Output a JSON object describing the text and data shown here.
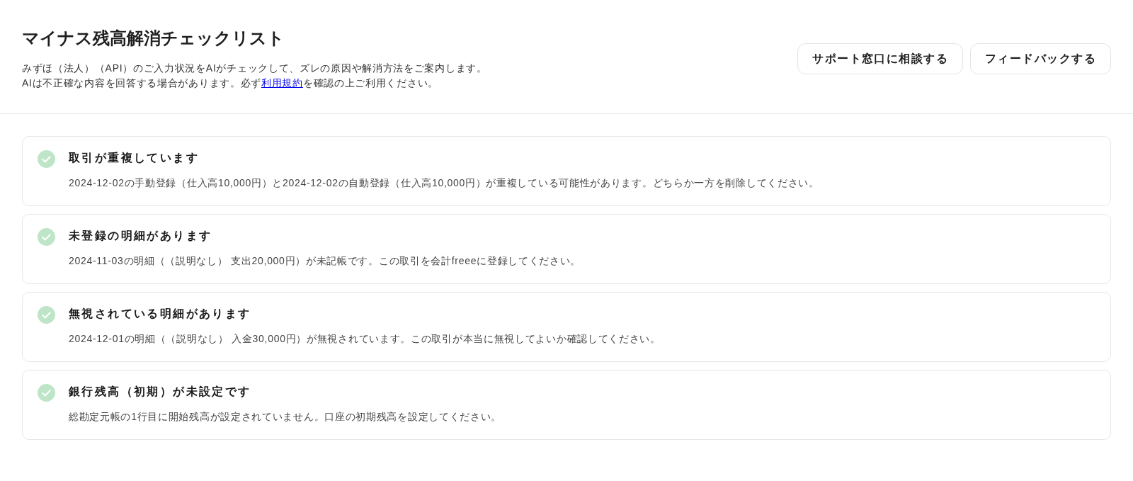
{
  "header": {
    "title": "マイナス残高解消チェックリスト",
    "description": "みずほ（法人）（API）のご入力状況をAIがチェックして、ズレの原因や解消方法をご案内します。",
    "notice": {
      "before": "AIは不正確な内容を回答する場合があります。必ず",
      "link": "利用規約",
      "after": "を確認の上ご利用ください。"
    },
    "buttons": [
      "サポート窓口に相談する",
      "フィードバックする"
    ]
  },
  "items": [
    {
      "title": "取引が重複しています",
      "detail": "2024-12-02の手動登録（仕入高10,000円）と2024-12-02の自動登録（仕入高10,000円）が重複している可能性があります。どちらか一方を削除してください。",
      "checked": true
    },
    {
      "title": "未登録の明細があります",
      "detail": "2024-11-03の明細（（説明なし） 支出20,000円）が未記帳です。この取引を会計freeeに登録してください。",
      "checked": true
    },
    {
      "title": "無視されている明細があります",
      "detail": "2024-12-01の明細（（説明なし） 入金30,000円）が無視されています。この取引が本当に無視してよいか確認してください。",
      "checked": true
    },
    {
      "title": "銀行残高（初期）が未設定です",
      "detail": "総勘定元帳の1行目に開始残高が設定されていません。口座の初期残高を設定してください。",
      "checked": true
    }
  ]
}
